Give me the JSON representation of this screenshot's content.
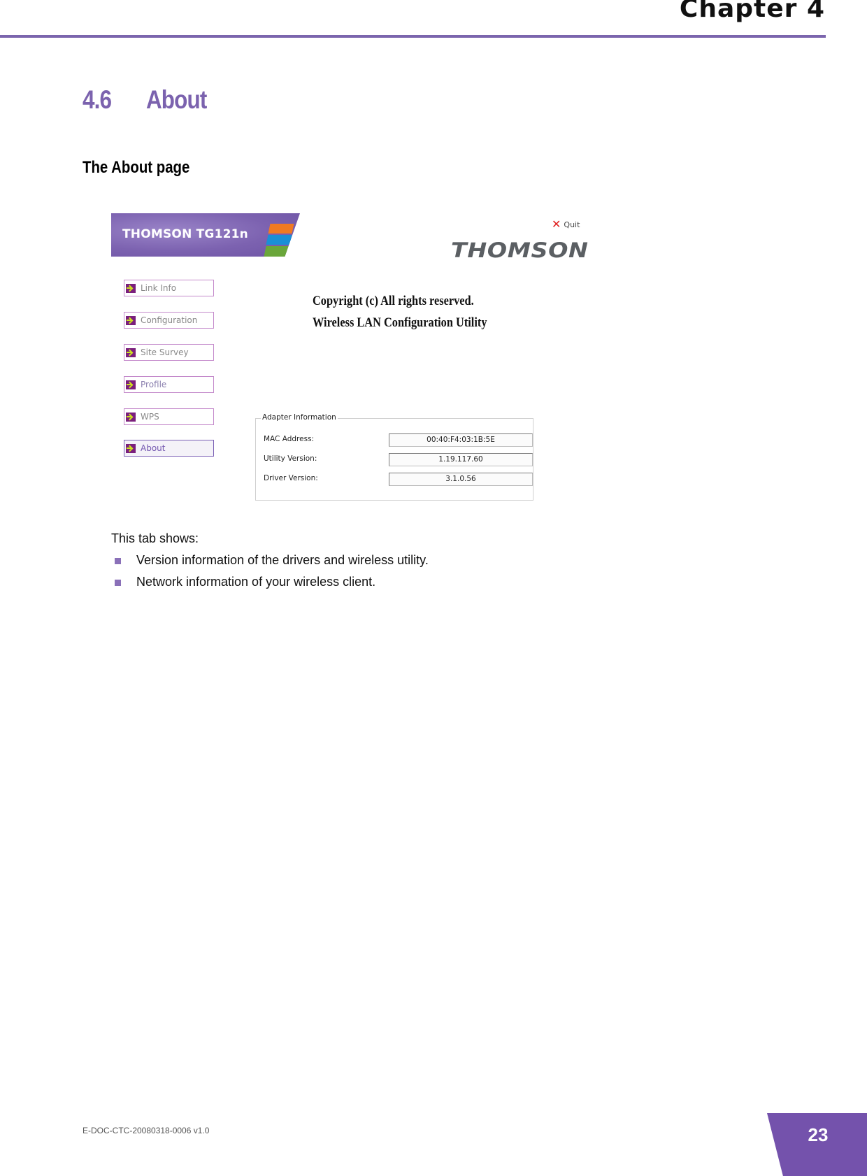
{
  "header": {
    "chapter": "Chapter 4",
    "rule_color": "#7b65ad"
  },
  "section": {
    "number": "4.6",
    "title": "About",
    "subheading": "The About page"
  },
  "figure": {
    "banner": {
      "product_name": "THOMSON TG121n",
      "stripe_colors": [
        "#f07a22",
        "#1a8fd6",
        "#6aa63a"
      ],
      "background_color": "#7c62b0"
    },
    "quit": {
      "icon": "close-x-icon",
      "label": "Quit"
    },
    "logo": "THOMSON",
    "nav": {
      "items": [
        {
          "label": "Link Info",
          "icon": "arrow-right-icon",
          "active": false
        },
        {
          "label": "Configuration",
          "icon": "arrow-right-icon",
          "active": false
        },
        {
          "label": "Site Survey",
          "icon": "arrow-right-icon",
          "active": false
        },
        {
          "label": "Profile",
          "icon": "arrow-right-icon",
          "active": false
        },
        {
          "label": "WPS",
          "icon": "arrow-right-icon",
          "active": false
        },
        {
          "label": "About",
          "icon": "arrow-right-icon",
          "active": true
        }
      ]
    },
    "about_text": {
      "line1": "Copyright (c)  All rights reserved.",
      "line2": "Wireless LAN Configuration Utility"
    },
    "adapter_info": {
      "legend": "Adapter Information",
      "rows": [
        {
          "label": "MAC Address:",
          "value": "00:40:F4:03:1B:5E"
        },
        {
          "label": "Utility Version:",
          "value": "1.19.117.60"
        },
        {
          "label": "Driver Version:",
          "value": "3.1.0.56"
        }
      ]
    }
  },
  "body": {
    "intro": "This tab shows:",
    "bullets": [
      "Version information of the drivers and wireless utility.",
      "Network information of your wireless client."
    ],
    "bullet_color": "#8a70b8"
  },
  "footer": {
    "doc_id": "E-DOC-CTC-20080318-0006 v1.0",
    "page_number": "23",
    "tab_color": "#7452ac"
  }
}
